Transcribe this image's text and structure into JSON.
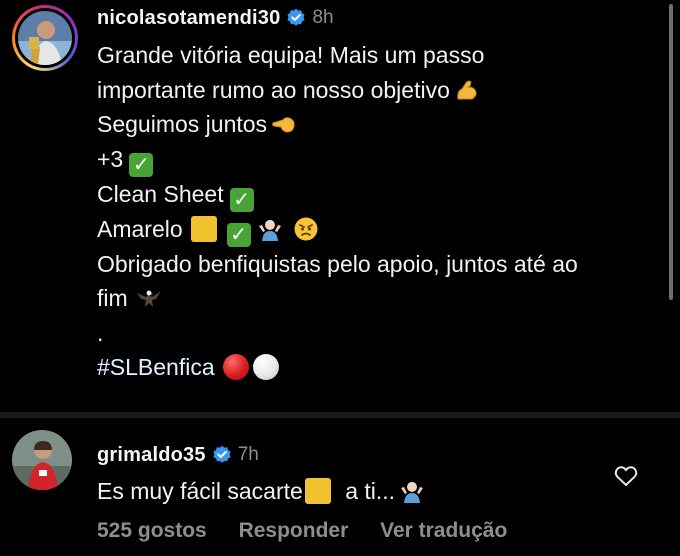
{
  "post": {
    "username": "nicolasotamendi30",
    "time": "8h",
    "caption": {
      "line1": "Grande vitória equipa! Mais um passo",
      "line2": "importante rumo ao nosso objetivo",
      "line3": "Seguimos juntos",
      "line4": "+3",
      "line5": "Clean Sheet",
      "line6": "Amarelo",
      "line7": "Obrigado benfiquistas pelo apoio, juntos até ao",
      "line8": "fim",
      "dot": ".",
      "hashtag": "#SLBenfica"
    }
  },
  "reply": {
    "username": "grimaldo35",
    "time": "7h",
    "text_before": "Es muy fácil sacarte",
    "text_after": "a ti...",
    "likes": "525 gostos",
    "reply_label": "Responder",
    "translate_label": "Ver tradução"
  },
  "icons": {
    "flexed_biceps": "flexed-biceps-icon",
    "saluting_hand": "pointing-hand-icon",
    "check_mark": "check-mark-icon",
    "shrug": "person-shrugging-icon",
    "angry": "angry-face-icon",
    "eagle": "eagle-icon",
    "red_circle": "red-circle-icon",
    "white_circle": "white-circle-icon",
    "verified": "verified-badge-icon",
    "heart": "heart-outline-icon"
  },
  "colors": {
    "background": "#000000",
    "text": "#f2f2f2",
    "muted": "#8e8e8e",
    "verified": "#3897f0",
    "hashtag": "#e0f1ff",
    "check": "#4aa336",
    "yellow": "#f2c12e",
    "red": "#d81e1e"
  }
}
